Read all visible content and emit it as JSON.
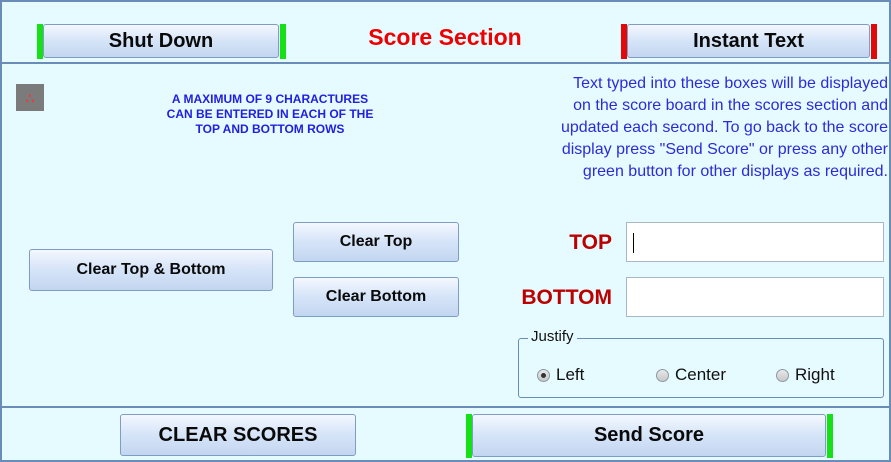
{
  "header": {
    "shutdown_label": "Shut Down",
    "title": "Score Section",
    "instant_text_label": "Instant Text"
  },
  "notice": {
    "lines": [
      "A MAXIMUM OF 9 CHARACTURES",
      "CAN BE ENTERED IN EACH OF THE",
      "TOP AND BOTTOM ROWS"
    ]
  },
  "info": {
    "lines": [
      "Text typed into these boxes will be displayed",
      "on the score board in the scores section and",
      "updated each second. To go back to the score",
      "display press \"Send Score\" or press any other",
      "green button for other displays as required."
    ]
  },
  "buttons": {
    "clear_top_bottom": "Clear Top & Bottom",
    "clear_top": "Clear Top",
    "clear_bottom": "Clear Bottom",
    "clear_scores": "CLEAR SCORES",
    "send_score": "Send Score"
  },
  "fields": {
    "top_label": "TOP",
    "top_value": "",
    "bottom_label": "BOTTOM",
    "bottom_value": ""
  },
  "justify": {
    "legend": "Justify",
    "options": [
      "Left",
      "Center",
      "Right"
    ],
    "selected": "Left"
  },
  "icons": {
    "corner_icon": "dots-icon"
  },
  "colors": {
    "background": "#e6fbff",
    "title_red": "#ee0000",
    "label_red": "#bb0000",
    "info_blue": "#2b2bd8",
    "green_bar": "#16e016",
    "red_bar": "#e00a0a"
  }
}
